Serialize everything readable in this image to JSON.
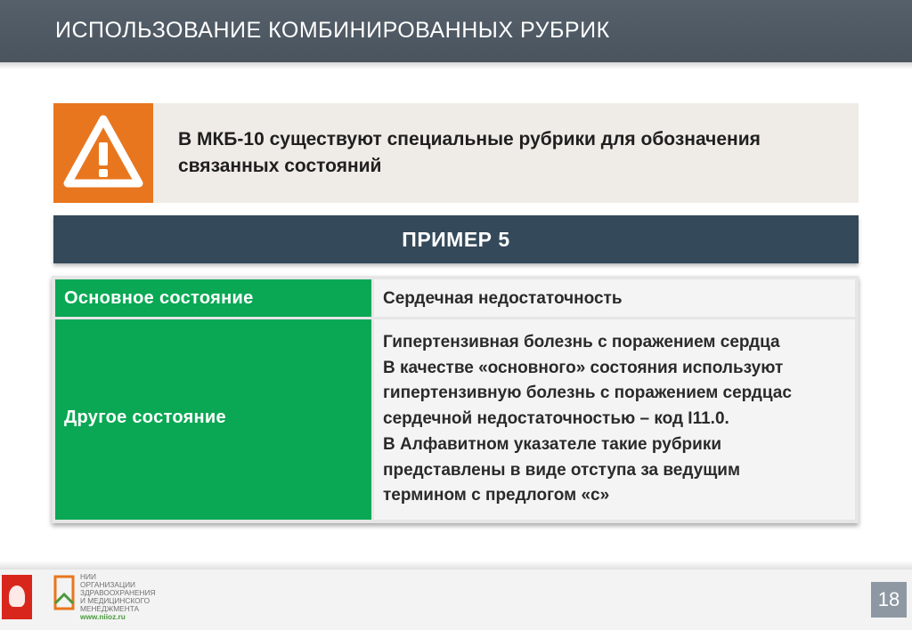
{
  "header": {
    "title": "ИСПОЛЬЗОВАНИЕ КОМБИНИРОВАННЫХ РУБРИК"
  },
  "warning": {
    "icon": "warning-triangle-icon",
    "text_lines": [
      "В МКБ-10 существуют специальные рубрики для обозначения",
      "связанных состояний"
    ]
  },
  "example": {
    "title": "ПРИМЕР 5"
  },
  "table": {
    "rows": [
      {
        "label": "Основное состояние",
        "value_lines": [
          "Сердечная недостаточность"
        ]
      },
      {
        "label": "Другое состояние",
        "value_lines": [
          "Гипертензивная болезнь с поражением сердца",
          "В качестве «основного» состояния используют",
          "гипертензивную болезнь с поражением сердцас",
          "сердечной недостаточностью – код I11.0.",
          "В Алфавитном указателе такие рубрики",
          "представлены в виде отступа за ведущим",
          "термином с предлогом «с»"
        ]
      }
    ]
  },
  "footer": {
    "org_lines": [
      "НИИ",
      "ОРГАНИЗАЦИИ",
      "ЗДРАВООХРАНЕНИЯ",
      "И МЕДИЦИНСКОГО",
      "МЕНЕДЖМЕНТА"
    ],
    "url": "www.niioz.ru",
    "page_number": "18"
  },
  "colors": {
    "header": "#505a64",
    "warning_orange": "#e8761e",
    "warning_bg": "#efebe6",
    "example_bar": "#34495a",
    "green": "#0aa854",
    "cell_light": "#f4f4f4",
    "page_badge": "#8d98a2"
  }
}
